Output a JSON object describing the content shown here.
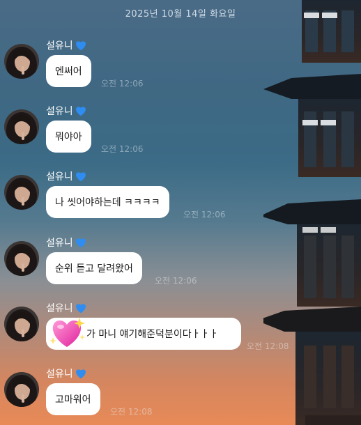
{
  "chat": {
    "date": "2025년 10월 14일 화요일",
    "sender_name": "설유니",
    "messages": [
      {
        "text": "엔써어",
        "time": "오전 12:06"
      },
      {
        "text": "뭐야아",
        "time": "오전 12:06"
      },
      {
        "text": "나 씻어야하는데 ㅋㅋㅋㅋ",
        "time": "오전 12:06"
      },
      {
        "text": "순위 듣고 달려왔어",
        "time": "오전 12:06"
      },
      {
        "text": "가 마니 얘기해준덕분이다ㅏㅏㅏ",
        "time": "오전 12:08",
        "sticker": "sparkling-heart-emoji"
      },
      {
        "text": "고마워어",
        "time": "오전 12:08"
      }
    ]
  },
  "colors": {
    "bubble": "#ffffff",
    "heart": "#2f8cf0"
  }
}
